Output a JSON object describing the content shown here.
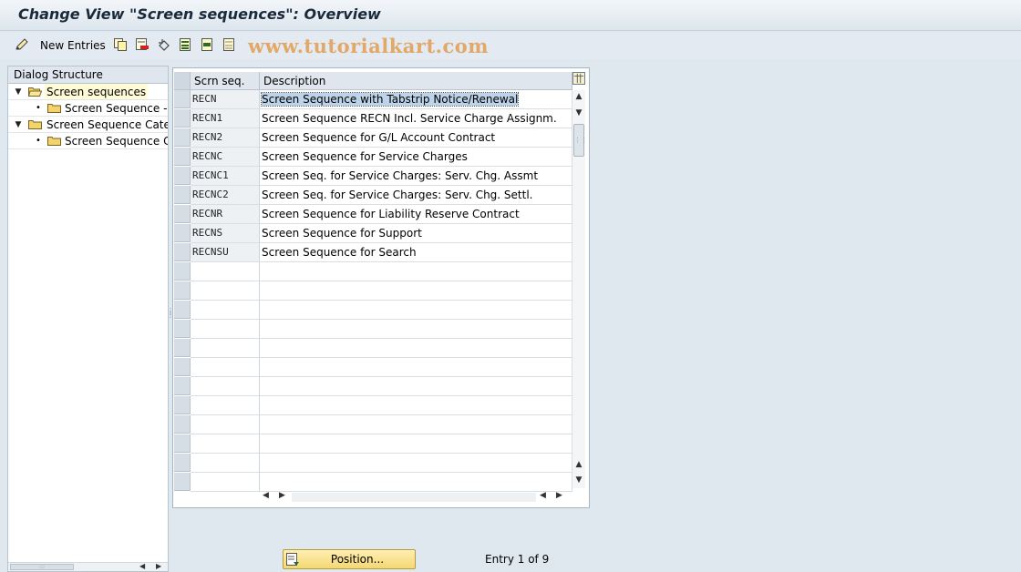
{
  "window": {
    "title": "Change View \"Screen sequences\": Overview"
  },
  "toolbar": {
    "new_entries_label": "New Entries",
    "icons": [
      "edit-pencil-icon",
      "copy-icon",
      "delete-icon",
      "undo-icon",
      "select-all-icon",
      "select-block-icon",
      "deselect-all-icon"
    ]
  },
  "watermark": "www.tutorialkart.com",
  "dialog_structure": {
    "header": "Dialog Structure",
    "items": [
      {
        "label": "Screen sequences",
        "level": 0,
        "expanded": true,
        "selected": true,
        "icon": "open-folder-icon"
      },
      {
        "label": "Screen Sequence ->",
        "level": 1,
        "expanded": false,
        "selected": false,
        "icon": "folder-icon"
      },
      {
        "label": "Screen Sequence Categ",
        "level": 0,
        "expanded": true,
        "selected": false,
        "icon": "folder-icon"
      },
      {
        "label": "Screen Sequence Ca",
        "level": 1,
        "expanded": false,
        "selected": false,
        "icon": "folder-icon"
      }
    ]
  },
  "table": {
    "columns": [
      "Scrn seq.",
      "Description"
    ],
    "rows": [
      {
        "code": "RECN",
        "description": "Screen Sequence with Tabstrip Notice/Renewal",
        "highlighted": true
      },
      {
        "code": "RECN1",
        "description": "Screen Sequence RECN Incl. Service Charge Assignm."
      },
      {
        "code": "RECN2",
        "description": "Screen Sequence for G/L Account Contract"
      },
      {
        "code": "RECNC",
        "description": "Screen Sequence for Service Charges"
      },
      {
        "code": "RECNC1",
        "description": "Screen Seq. for Service Charges: Serv. Chg. Assmt"
      },
      {
        "code": "RECNC2",
        "description": "Screen Seq. for Service Charges: Serv. Chg. Settl."
      },
      {
        "code": "RECNR",
        "description": "Screen Sequence for Liability Reserve Contract"
      },
      {
        "code": "RECNS",
        "description": "Screen Sequence for Support"
      },
      {
        "code": "RECNSU",
        "description": "Screen Sequence for Search"
      }
    ],
    "empty_rows": 12
  },
  "footer": {
    "position_button_label": "Position...",
    "entry_text": "Entry 1 of 9"
  },
  "colors": {
    "background": "#dfe7ef",
    "selected_tree_item": "#fffbd6",
    "button_yellow": "#f4d774",
    "highlight": "#bcd3ea"
  }
}
